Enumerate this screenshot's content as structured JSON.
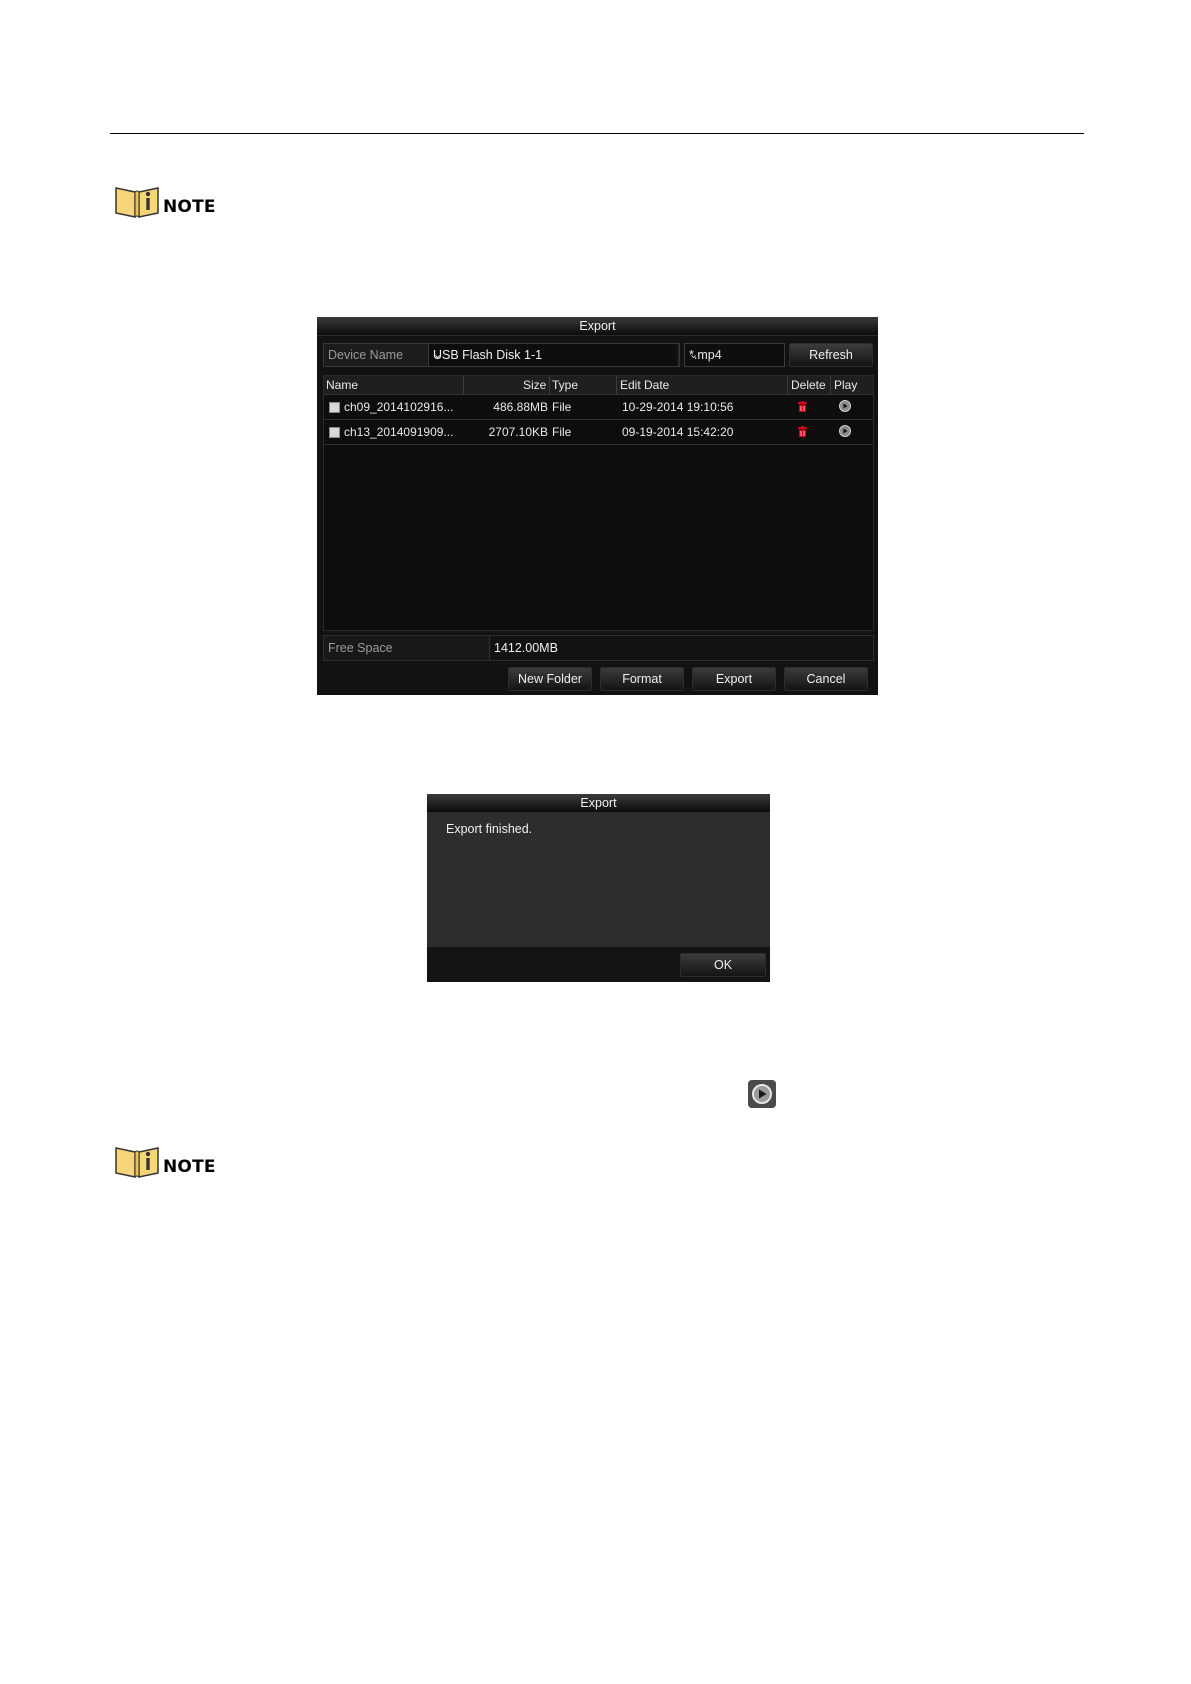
{
  "note_label": "NOTE",
  "export_dialog": {
    "title": "Export",
    "device_name_label": "Device Name",
    "device_name_value": "USB Flash Disk 1-1",
    "file_type_value": "*.mp4",
    "refresh_label": "Refresh",
    "columns": {
      "name": "Name",
      "size": "Size",
      "type": "Type",
      "edit_date": "Edit Date",
      "delete": "Delete",
      "play": "Play"
    },
    "rows": [
      {
        "name": "ch09_2014102916...",
        "size": "486.88MB",
        "type": "File",
        "edit_date": "10-29-2014 19:10:56"
      },
      {
        "name": "ch13_2014091909...",
        "size": "2707.10KB",
        "type": "File",
        "edit_date": "09-19-2014 15:42:20"
      }
    ],
    "free_space_label": "Free Space",
    "free_space_value": "1412.00MB",
    "buttons": {
      "new_folder": "New Folder",
      "format": "Format",
      "export": "Export",
      "cancel": "Cancel"
    }
  },
  "finished_dialog": {
    "title": "Export",
    "message": "Export finished.",
    "ok_label": "OK"
  },
  "icons": {
    "note": "note-book-icon",
    "delete": "trash-icon",
    "play": "play-icon"
  },
  "colors": {
    "dialog_bg": "#121212",
    "delete_icon": "#d0021b",
    "note_yellow": "#f7d67a"
  }
}
